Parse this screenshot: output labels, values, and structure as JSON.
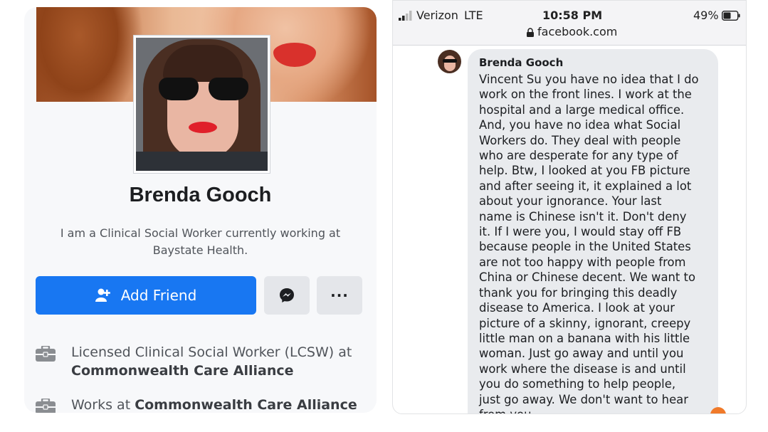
{
  "profile": {
    "name": "Brenda Gooch",
    "bio": "I am a Clinical Social Worker currently working at Baystate Health.",
    "actions": {
      "add_friend_label": "Add Friend",
      "more_label": "···"
    },
    "work": [
      {
        "prefix": "Licensed Clinical Social Worker (LCSW) at ",
        "org": "Commonwealth Care Alliance",
        "icon": "briefcase-icon"
      },
      {
        "prefix": "Works at ",
        "org": "Commonwealth Care Alliance",
        "icon": "briefcase-icon"
      }
    ],
    "colors": {
      "primary_button": "#1877f2",
      "secondary_button": "#e4e6ea"
    }
  },
  "phone": {
    "status_bar": {
      "carrier": "Verizon",
      "network": "LTE",
      "time": "10:58 PM",
      "battery": "49%",
      "url": "facebook.com"
    },
    "message": {
      "sender": "Brenda Gooch",
      "text": "Vincent Su you have no idea that I do\nwork on the front lines. I work at the\nhospital and a large medical office.\nAnd, you have no idea what Social\nWorkers do. They deal with people\nwho are desperate for any type of\nhelp. Btw, I looked at you FB picture\nand after seeing it, it explained a lot\nabout your ignorance. Your last\nname is Chinese isn't it. Don't deny\nit. If I were you, I would stay off FB\nbecause people in the United States\nare not too happy with people from\nChina or Chinese decent. We want to\nthank you for bringing this deadly\ndisease to America. I look at your\npicture of a skinny, ignorant, creepy\nlittle man on a banana with his little\nwoman. Just go away and until you\nwork where the disease is and until\nyou do something to help people,\njust go away. We don't want to hear\nfrom you."
    }
  }
}
